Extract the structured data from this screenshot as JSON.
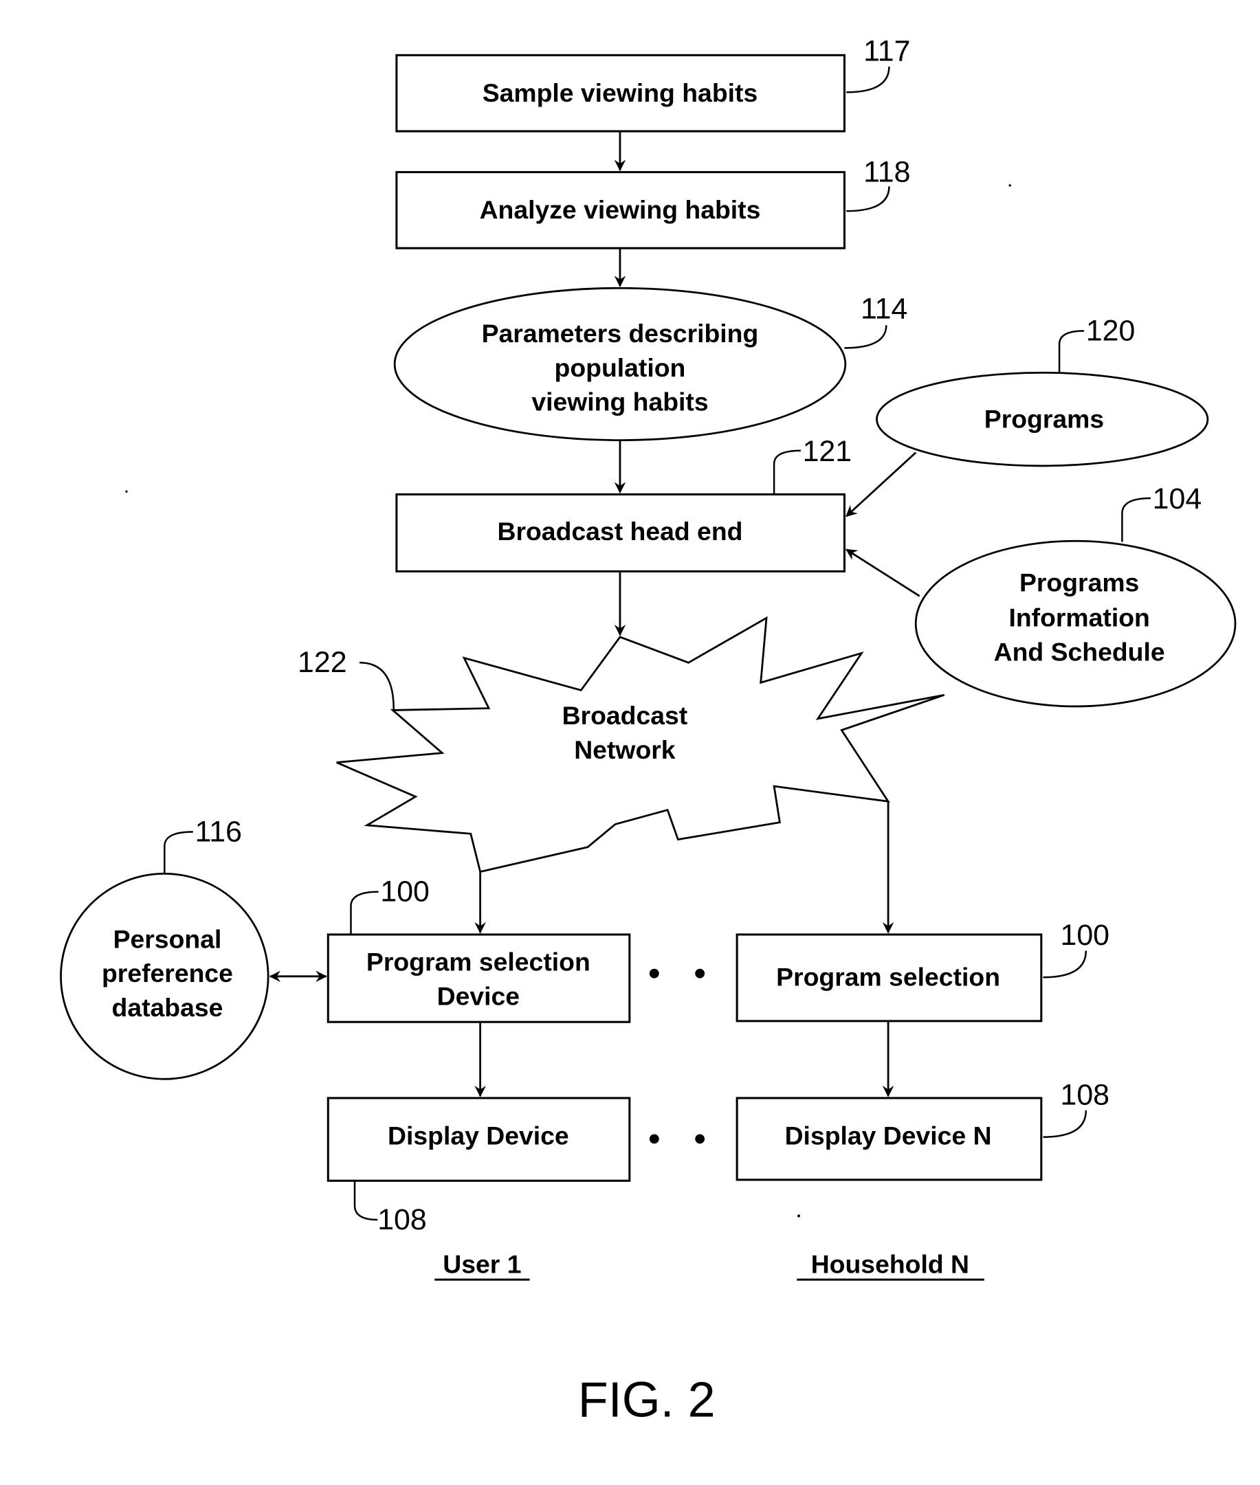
{
  "figure": {
    "caption": "FIG. 2",
    "nodes": {
      "sample": {
        "label": "Sample viewing habits",
        "ref": "117"
      },
      "analyze": {
        "label": "Analyze viewing habits",
        "ref": "118"
      },
      "parameters": {
        "lines": [
          "Parameters describing",
          "population",
          "viewing habits"
        ],
        "ref": "114"
      },
      "programs": {
        "label": "Programs",
        "ref": "120"
      },
      "headend": {
        "label": "Broadcast head end",
        "ref": "121"
      },
      "schedule": {
        "lines": [
          "Programs",
          "Information",
          "And Schedule"
        ],
        "ref": "104"
      },
      "network": {
        "lines": [
          "Broadcast",
          "Network"
        ],
        "ref": "122"
      },
      "preference_db": {
        "lines": [
          "Personal",
          "preference",
          "database"
        ],
        "ref": "116"
      },
      "selection_1": {
        "lines": [
          "Program selection",
          "Device"
        ],
        "ref": "100"
      },
      "selection_n": {
        "label": "Program selection",
        "ref": "100"
      },
      "display_1": {
        "label": "Display Device",
        "ref": "108"
      },
      "display_n": {
        "label": "Display Device N",
        "ref": "108"
      }
    },
    "column_labels": {
      "left": "User 1",
      "right": "Household N"
    }
  }
}
